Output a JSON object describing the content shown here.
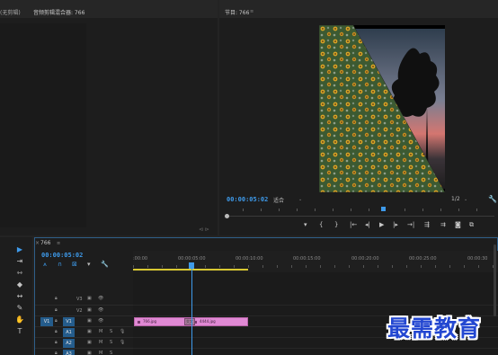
{
  "source_panel": {
    "tab_source_partial": "(无剪辑)",
    "tab_audio_mixer": "音频剪辑混合器: 766"
  },
  "program_panel": {
    "title": "节目: 766",
    "timecode": "00:00:05:02",
    "fit": "适合",
    "resolution": "1/2",
    "buttons": [
      "marker",
      "in",
      "out",
      "go-in",
      "step-back",
      "play",
      "step-fwd",
      "go-out",
      "insert",
      "overwrite",
      "export-frame",
      "compare"
    ]
  },
  "timeline": {
    "sequence_name": "766",
    "timecode": "00:00:05:02",
    "ruler_labels": [
      ":00:00",
      "00:00:05:00",
      "00:00:10:00",
      "00:00:15:00",
      "00:00:20:00",
      "00:00:25:00",
      "00:00:30"
    ],
    "tracks": [
      {
        "name": "V3",
        "type": "video"
      },
      {
        "name": "V2",
        "type": "video"
      },
      {
        "name": "V1",
        "type": "video",
        "source": "V1",
        "target_on": true
      },
      {
        "name": "A1",
        "type": "audio",
        "target_on": true
      },
      {
        "name": "A2",
        "type": "audio"
      },
      {
        "name": "A3",
        "type": "audio"
      }
    ],
    "audio_flags": {
      "mute": "M",
      "solo": "S"
    },
    "clips": [
      {
        "name": "766.jpg"
      },
      {
        "name": "4444.jpg"
      }
    ],
    "transition_label": "交叉"
  },
  "tools": [
    "selection",
    "track-select",
    "ripple-edit",
    "razor",
    "slip",
    "pen",
    "hand",
    "type"
  ],
  "watermark": "最需教育",
  "colors": {
    "accent": "#3e9aea",
    "clip": "#e089d4",
    "work_area": "#d8c832"
  }
}
